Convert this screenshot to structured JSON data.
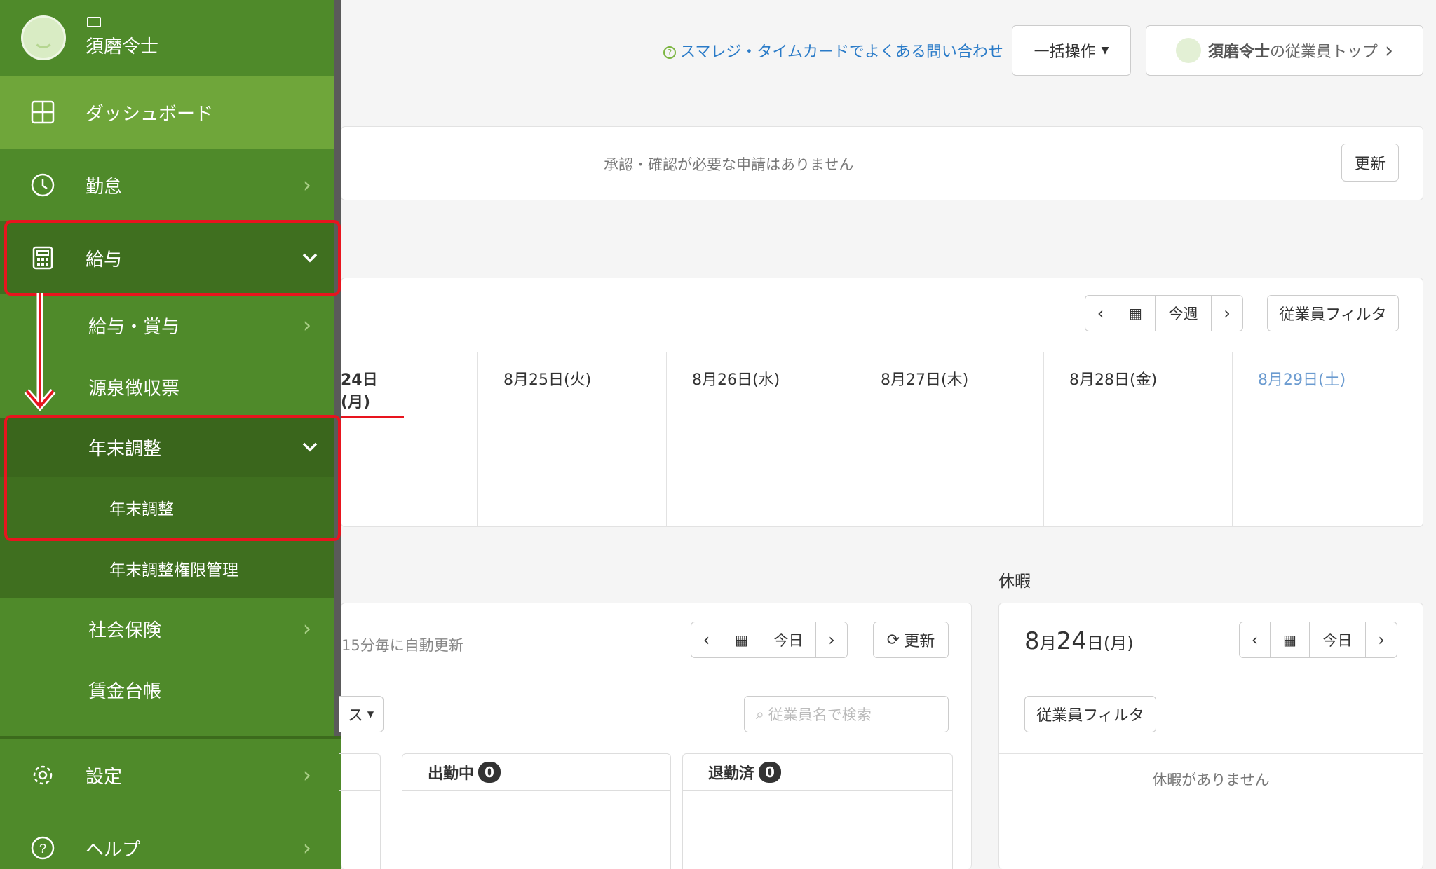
{
  "sidebar": {
    "user_name": "須磨令士",
    "items": [
      {
        "label": "ダッシュボード"
      },
      {
        "label": "勤怠"
      },
      {
        "label": "給与"
      },
      {
        "label": "給与・賞与"
      },
      {
        "label": "源泉徴収票"
      },
      {
        "label": "年末調整"
      },
      {
        "label": "年末調整"
      },
      {
        "label": "年末調整権限管理"
      },
      {
        "label": "社会保険"
      },
      {
        "label": "賃金台帳"
      },
      {
        "label": "設定"
      },
      {
        "label": "ヘルプ"
      }
    ]
  },
  "header": {
    "faq_link": "スマレジ・タイムカードでよくある問い合わせ",
    "bulk_button": "一括操作",
    "employee_top_name": "須磨令士",
    "employee_top_suffix": "の従業員トップ"
  },
  "approvals": {
    "message": "承認・確認が必要な申請はありません",
    "refresh": "更新"
  },
  "week": {
    "today_button": "今週",
    "filter_button": "従業員フィルタ",
    "days": [
      "24日(月)",
      "8月25日(火)",
      "8月26日(水)",
      "8月27日(木)",
      "8月28日(金)",
      "8月29日(土)"
    ]
  },
  "attendance": {
    "auto_refresh": "15分毎に自動更新",
    "today_button": "今日",
    "refresh": "更新",
    "dropdown_fragment": "ス",
    "search_placeholder": "従業員名で検索",
    "col_working": "出勤中",
    "col_working_count": "0",
    "col_left": "退勤済",
    "col_left_count": "0"
  },
  "leave": {
    "title": "休暇",
    "date_month": "8",
    "date_month_suffix": "月",
    "date_day": "24",
    "date_day_suffix": "日(月)",
    "today_button": "今日",
    "filter_button": "従業員フィルタ",
    "empty": "休暇がありません"
  },
  "colors": {
    "sidebar_green": "#4f8a2a",
    "active_green": "#6fa63a",
    "dark_green": "#3f6f1f",
    "highlight_red": "#e8141e",
    "link_blue": "#2a7bc8",
    "saturday_blue": "#6b9bd0"
  }
}
